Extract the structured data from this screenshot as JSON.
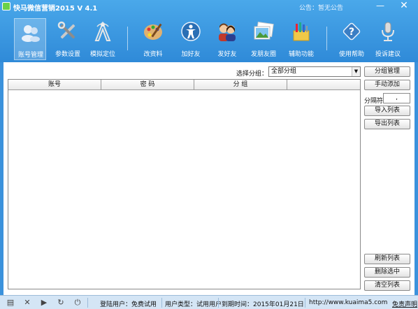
{
  "window": {
    "title": "快马微信营销2015  V 4.1",
    "notice": "公告：暂无公告",
    "minimize": "—",
    "close": "✕"
  },
  "toolbar": {
    "items": [
      {
        "label": "账号管理",
        "icon": "accounts-icon"
      },
      {
        "label": "参数设置",
        "icon": "tools-icon"
      },
      {
        "label": "模拟定位",
        "icon": "location-icon"
      },
      {
        "label": "改资料",
        "icon": "palette-icon"
      },
      {
        "label": "加好友",
        "icon": "add-friend-icon"
      },
      {
        "label": "发好友",
        "icon": "send-friend-icon"
      },
      {
        "label": "发朋友圈",
        "icon": "photos-icon"
      },
      {
        "label": "辅助功能",
        "icon": "helper-icon"
      },
      {
        "label": "使用帮助",
        "icon": "help-icon"
      },
      {
        "label": "投诉建议",
        "icon": "microphone-icon"
      }
    ],
    "active_index": 0
  },
  "main": {
    "group_label": "选择分组：",
    "group_value": "全部分组",
    "columns": [
      "账号",
      "密 码",
      "分 组"
    ],
    "separator_label": "分隔符",
    "separator_value": ",",
    "buttons": {
      "group_manage": "分组管理",
      "manual_add": "手动添加",
      "import_list": "导入列表",
      "export_list": "导出列表",
      "refresh_list": "刷新列表",
      "delete_selected": "删除选中",
      "clear_list": "清空列表"
    }
  },
  "statusbar": {
    "login_user": "登陆用户：免费试用",
    "user_type": "用户类型：试用用户",
    "expire": "到期时间：2015年01月21日",
    "website": "http://www.kuaima5.com",
    "disclaimer": "免责声明"
  },
  "colors": {
    "accent": "#2f8ad8",
    "status_bg": "#d4e5f5"
  }
}
